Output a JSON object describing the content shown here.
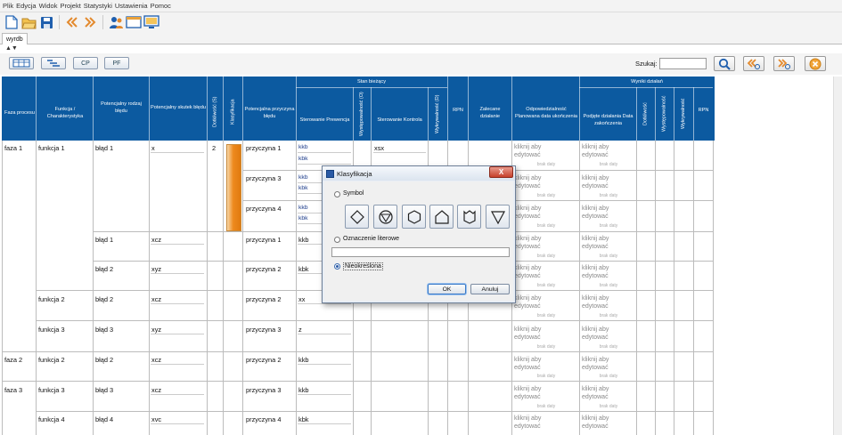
{
  "menubar": {
    "items": [
      "Plik",
      "Edycja",
      "Widok",
      "Projekt",
      "Statystyki",
      "Ustawienia",
      "Pomoc"
    ]
  },
  "toolbar": {
    "icons": [
      "new-document-icon",
      "open-folder-icon",
      "save-icon",
      "back-icon",
      "forward-icon",
      "users-icon",
      "window-icon",
      "monitor-icon"
    ]
  },
  "tab": {
    "label": "wyrdb"
  },
  "collapse_glyph": "▲▼",
  "viewbar": {
    "buttons": [
      "",
      "",
      "CP",
      "PF"
    ]
  },
  "search": {
    "label": "Szukaj:",
    "value": "",
    "placeholder": ""
  },
  "header": {
    "faza": "Faza procesu",
    "funkcja": "Funkcja / Charakterystyka",
    "rodzaj": "Potencjalny rodzaj błędu",
    "skutek": "Potencjalny skutek błędu",
    "dotkliwosc": "Dotkliwość (S)",
    "klasyfikacja": "Klasyfikacja",
    "przyczyna": "Potencjalna przyczyna błędu",
    "stan": "Stan bieżący",
    "prewencja": "Sterowanie Prewencja",
    "wyst": "Występowalność (O)",
    "kontrola": "Sterowanie Kontrola",
    "wykr": "Wykrywalność (D)",
    "rpn": "RPN",
    "zalecane": "Zalecane działanie",
    "odpowiedzialnosc": "Odpowiedzialność Planowana data ukończenia",
    "wyniki": "Wyniki działań",
    "podjete": "Podjęte działania Data zakończenia",
    "w_dotkliwosc": "Dotkliwość",
    "w_wyst": "Występowalność",
    "w_wykr": "Wykrywalność",
    "w_rpn": "RPN"
  },
  "cells": {
    "faza1": "faza 1",
    "faza2": "faza 2",
    "faza3": "faza 3",
    "f1": "funkcja 1",
    "f2": "funkcja 2",
    "f3": "funkcja 3",
    "f2b": "funkcja 2",
    "f3b": "funkcja 3",
    "f4": "funkcja 4",
    "b1": "błąd 1",
    "b1b": "błąd 1",
    "b2": "błąd 2",
    "b2b": "błąd 2",
    "b3": "błąd 3",
    "b2c": "błąd 2",
    "b3b": "błąd 3",
    "b4": "błąd 4",
    "s1": "x",
    "s2": "xcz",
    "s3": "xyz",
    "s4": "xcz",
    "s5": "xyz",
    "s6": "xcz",
    "s7": "xcz",
    "s8": "xvc",
    "sev1": "2",
    "p1": "przyczyna 1",
    "p3": "przyczyna 3",
    "p4": "przyczyna 4",
    "p1b": "przyczyna 1",
    "p2": "przyczyna 2",
    "p2b": "przyczyna 2",
    "p3b": "przyczyna 3",
    "p2c": "przyczyna 2",
    "p3c": "przyczyna 3",
    "p4b": "przyczyna 4",
    "pr1a": "kkb",
    "pr1b": "kbk",
    "pr2a": "kkb",
    "pr2b": "kbk",
    "pr3a": "kkb",
    "pr3b": "kbk",
    "pr4": "kkb",
    "pr5": "kbk",
    "pr6": "xx",
    "pr7": "z",
    "pr8": "kkb",
    "pr9": "kkb",
    "pr10": "kbk",
    "k1": "xsx"
  },
  "placeholders": {
    "click_edit_1": "kliknij aby",
    "click_edit_2": "edytować",
    "date": "brak daty"
  },
  "dialog": {
    "title": "Klasyfikacja",
    "close": "X",
    "symbol_label": "Symbol",
    "letter_label": "Oznaczenie literowe",
    "letter_value": "",
    "undefined_label": "Nieokreślona",
    "selected": "Nieokreślona",
    "ok": "OK",
    "cancel": "Anuluj",
    "symbols": [
      "diamond-icon",
      "circle-triangle-icon",
      "hexagon-icon",
      "pentagon-icon",
      "shield-icon",
      "triangle-down-icon"
    ]
  },
  "colors": {
    "header": "#0c5aa0",
    "orange": "#ee8a1e",
    "dialog_bg": "#e9eef5"
  }
}
